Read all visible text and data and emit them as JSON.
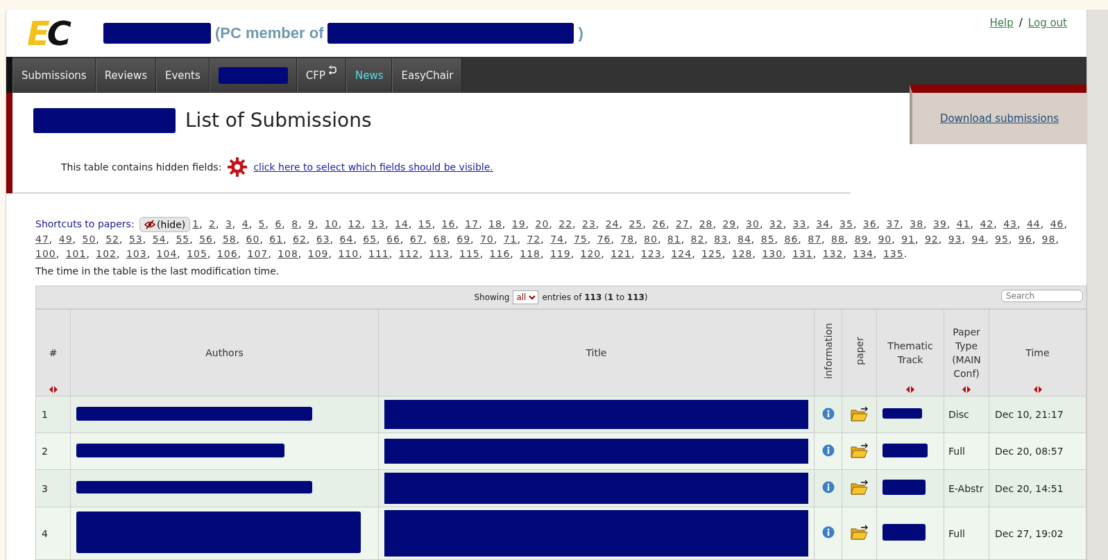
{
  "logo": {
    "text": "EC"
  },
  "header": {
    "member_prefix": "(PC member of",
    "member_suffix": ")",
    "links": [
      "Help",
      "Log out"
    ],
    "link_separator": "/"
  },
  "nav": [
    {
      "kind": "text",
      "label": "Submissions",
      "highlighted": false
    },
    {
      "kind": "text",
      "label": "Reviews",
      "highlighted": false
    },
    {
      "kind": "text",
      "label": "Events",
      "highlighted": false
    },
    {
      "kind": "redacted"
    },
    {
      "kind": "icon",
      "label": "CFP",
      "highlighted": false
    },
    {
      "kind": "text",
      "label": "News",
      "highlighted": true
    },
    {
      "kind": "text",
      "label": "EasyChair",
      "highlighted": false
    }
  ],
  "page_title": "List of Submissions",
  "download_link": "Download submissions",
  "hidden_fields": {
    "text": "This table contains hidden fields:",
    "link": "click here to select which fields should be visible."
  },
  "shortcuts": {
    "label": "Shortcuts to papers:",
    "hide_button": "(hide)",
    "separator": ",",
    "end": ".",
    "papers": [
      "1",
      "2",
      "3",
      "4",
      "5",
      "6",
      "8",
      "9",
      "10",
      "12",
      "13",
      "14",
      "15",
      "16",
      "17",
      "18",
      "19",
      "20",
      "22",
      "23",
      "24",
      "25",
      "26",
      "27",
      "28",
      "29",
      "30",
      "32",
      "33",
      "34",
      "35",
      "36",
      "37",
      "38",
      "39",
      "41",
      "42",
      "43",
      "44",
      "46",
      "47",
      "49",
      "50",
      "52",
      "53",
      "54",
      "55",
      "56",
      "58",
      "60",
      "61",
      "62",
      "63",
      "64",
      "65",
      "66",
      "67",
      "68",
      "69",
      "70",
      "71",
      "72",
      "74",
      "75",
      "76",
      "78",
      "80",
      "81",
      "82",
      "83",
      "84",
      "85",
      "86",
      "87",
      "88",
      "89",
      "90",
      "91",
      "92",
      "93",
      "94",
      "95",
      "96",
      "98",
      "100",
      "101",
      "102",
      "103",
      "104",
      "105",
      "106",
      "107",
      "108",
      "109",
      "110",
      "111",
      "112",
      "113",
      "115",
      "116",
      "118",
      "119",
      "120",
      "121",
      "123",
      "124",
      "125",
      "128",
      "130",
      "131",
      "132",
      "134",
      "135"
    ]
  },
  "note": "The time in the table is the last modification time.",
  "table": {
    "showing": "Showing",
    "page_size": "all",
    "entries": "entries of **113** (**1** to **113**)",
    "search": {
      "placeholder": "Search"
    },
    "columns": [
      {
        "label": "#",
        "sortable": true,
        "vertical": false
      },
      {
        "label": "Authors",
        "sortable": false,
        "vertical": false
      },
      {
        "label": "Title",
        "sortable": false,
        "vertical": false
      },
      {
        "label": "information",
        "sortable": false,
        "vertical": true
      },
      {
        "label": "paper",
        "sortable": false,
        "vertical": true
      },
      {
        "label": "Thematic Track",
        "sortable": true,
        "vertical": false
      },
      {
        "label": "Paper Type (MAIN Conf)",
        "sortable": true,
        "vertical": false
      },
      {
        "label": "Time",
        "sortable": true,
        "vertical": false
      }
    ],
    "rows": [
      {
        "number": "1",
        "paper_type": "Disc",
        "time": "Dec 10, 21:17"
      },
      {
        "number": "2",
        "paper_type": "Full",
        "time": "Dec 20, 08:57"
      },
      {
        "number": "3",
        "paper_type": "E-Abstr",
        "time": "Dec 20, 14:51"
      },
      {
        "number": "4",
        "paper_type": "Full",
        "time": "Dec 27, 19:02"
      }
    ]
  }
}
